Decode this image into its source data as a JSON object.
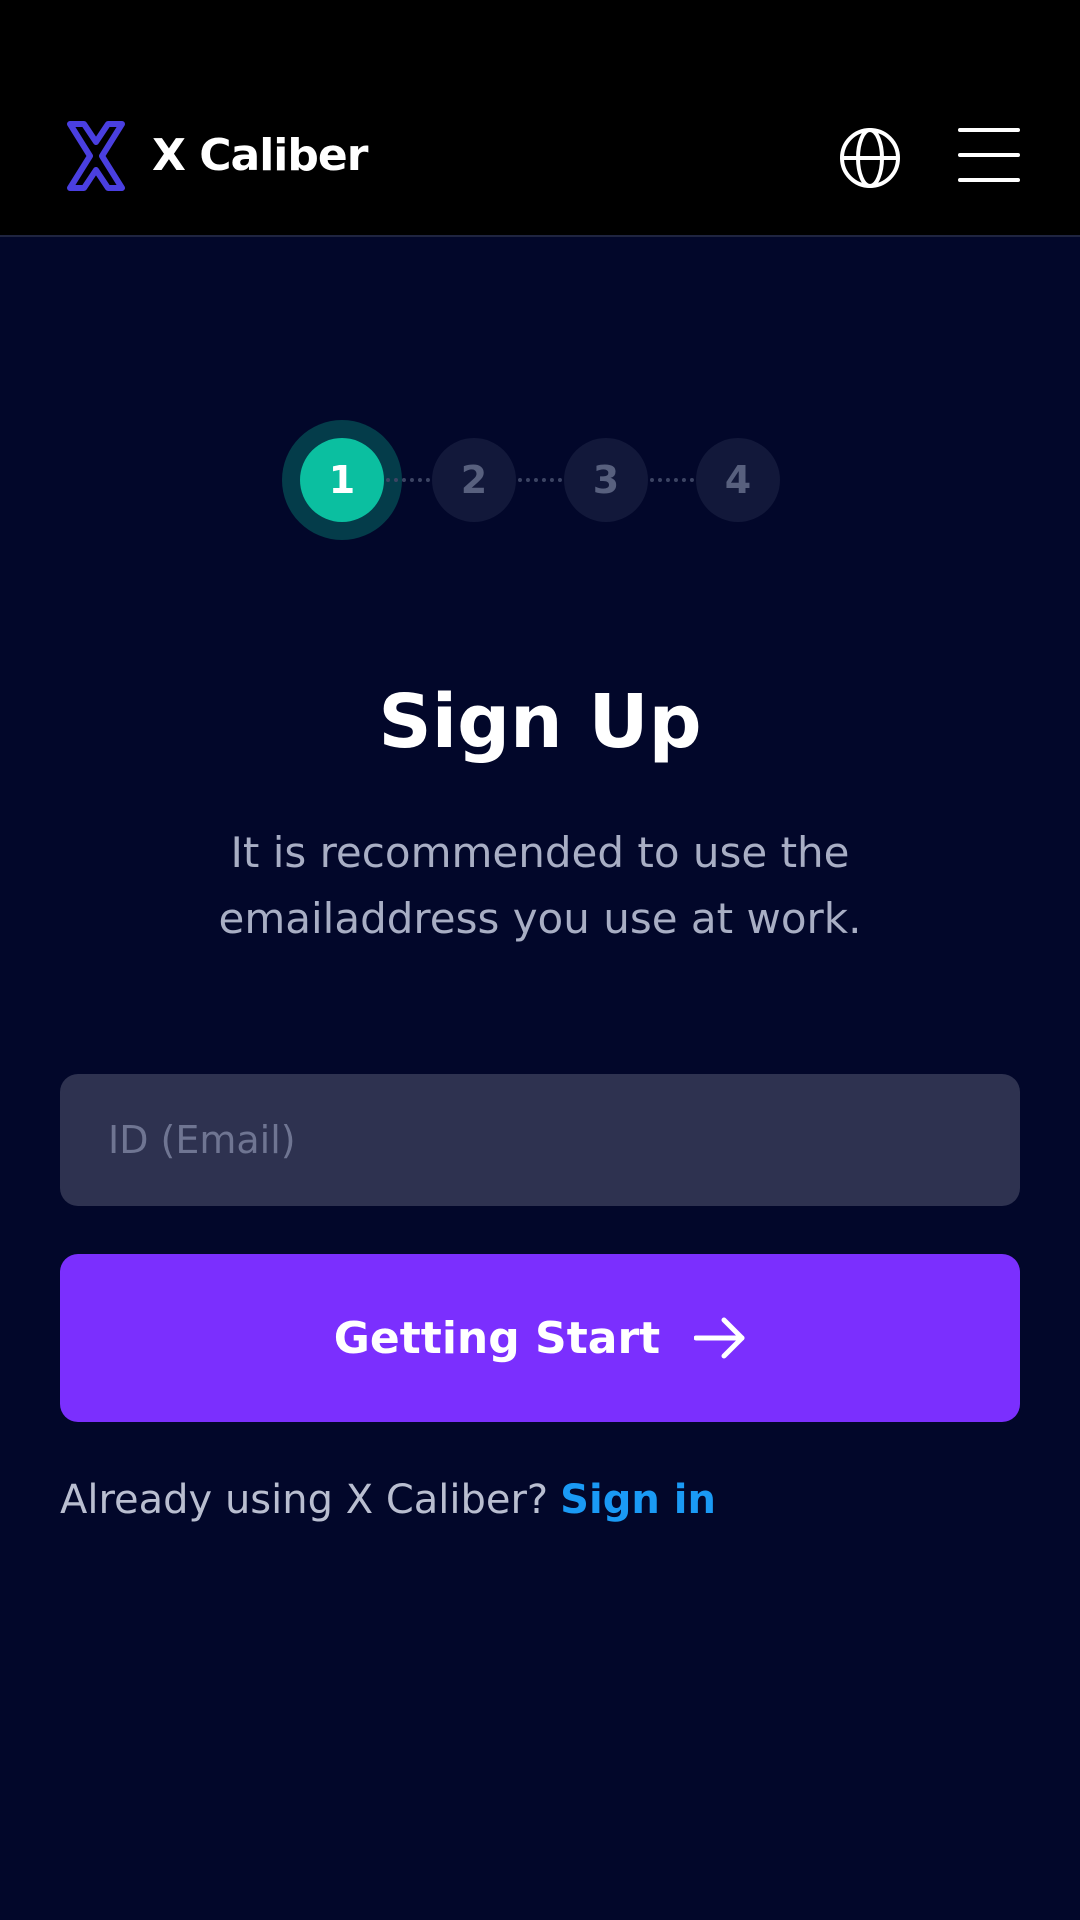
{
  "header": {
    "brand": "X Caliber",
    "globe_icon": "globe-icon",
    "menu_icon": "hamburger-menu-icon"
  },
  "stepper": {
    "steps": [
      "1",
      "2",
      "3",
      "4"
    ],
    "active_index": 0
  },
  "main": {
    "title": "Sign Up",
    "subtitle": "It is recommended to use the emailaddress you use at work.",
    "email_placeholder": "ID (Email)",
    "cta_label": "Getting Start",
    "cta_icon": "arrow-right-icon",
    "signin_prompt": "Already using X Caliber?",
    "signin_link": "Sign in"
  },
  "colors": {
    "background": "#02072a",
    "header": "#000000",
    "accent": "#7b2ffe",
    "step_active": "#0bbfa0",
    "link": "#1a9af5",
    "input_bg": "#2e3250",
    "logo": "#4a3fe0"
  }
}
